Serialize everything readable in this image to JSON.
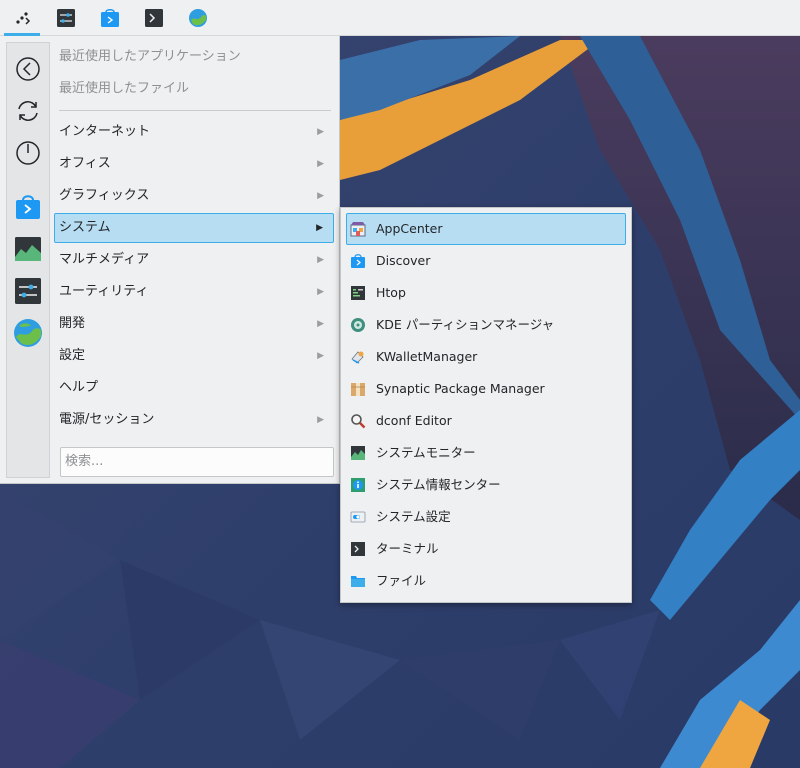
{
  "panel": {
    "tasks": [
      {
        "name": "application-launcher-icon",
        "active": true
      },
      {
        "name": "system-settings-icon",
        "active": false
      },
      {
        "name": "discover-store-icon",
        "active": false
      },
      {
        "name": "terminal-icon",
        "active": false
      },
      {
        "name": "web-browser-icon",
        "active": false
      }
    ]
  },
  "sidebar": {
    "icons": [
      "back-icon",
      "refresh-icon",
      "power-icon",
      "store-icon",
      "system-monitor-icon",
      "settings-icon",
      "browser-icon"
    ]
  },
  "menu": {
    "recent_apps": "最近使用したアプリケーション",
    "recent_files": "最近使用したファイル",
    "items": [
      {
        "label": "インターネット",
        "has_submenu": true
      },
      {
        "label": "オフィス",
        "has_submenu": true
      },
      {
        "label": "グラフィックス",
        "has_submenu": true
      },
      {
        "label": "システム",
        "has_submenu": true
      },
      {
        "label": "マルチメディア",
        "has_submenu": true
      },
      {
        "label": "ユーティリティ",
        "has_submenu": true
      },
      {
        "label": "開発",
        "has_submenu": true
      },
      {
        "label": "設定",
        "has_submenu": true
      },
      {
        "label": "ヘルプ",
        "has_submenu": false
      },
      {
        "label": "電源/セッション",
        "has_submenu": true
      }
    ],
    "arrow": "▶",
    "search_placeholder": "検索..."
  },
  "submenu": {
    "items": [
      {
        "label": "AppCenter",
        "icon": "appcenter-icon"
      },
      {
        "label": "Discover",
        "icon": "discover-icon"
      },
      {
        "label": "Htop",
        "icon": "htop-icon"
      },
      {
        "label": "KDE パーティションマネージャ",
        "icon": "partition-manager-icon"
      },
      {
        "label": "KWalletManager",
        "icon": "kwallet-icon"
      },
      {
        "label": "Synaptic Package Manager",
        "icon": "synaptic-icon"
      },
      {
        "label": "dconf Editor",
        "icon": "dconf-editor-icon"
      },
      {
        "label": "システムモニター",
        "icon": "system-monitor-icon"
      },
      {
        "label": "システム情報センター",
        "icon": "info-center-icon"
      },
      {
        "label": "システム設定",
        "icon": "system-settings-icon"
      },
      {
        "label": "ターミナル",
        "icon": "terminal-icon"
      },
      {
        "label": "ファイル",
        "icon": "folder-icon"
      }
    ]
  },
  "colors": {
    "accent": "#3daee9",
    "highlight": "#b7ddf3",
    "panel_bg": "#eff0f1"
  }
}
